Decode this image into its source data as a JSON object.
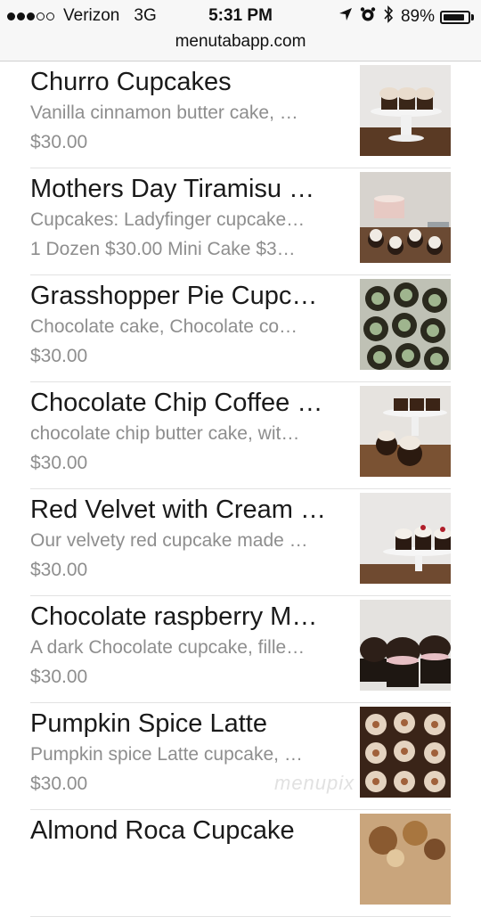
{
  "status_bar": {
    "signal_bars_filled": 3,
    "signal_bars_total": 5,
    "carrier": "Verizon",
    "network": "3G",
    "time": "5:31 PM",
    "battery_percent": "89%",
    "battery_level": 0.89,
    "icons": [
      "location-arrow-icon",
      "alarm-clock-icon",
      "bluetooth-icon",
      "battery-icon"
    ]
  },
  "browser": {
    "url": "menutabapp.com"
  },
  "menu_items": [
    {
      "title": "Churro Cupcakes",
      "description": "Vanilla cinnamon butter cake, …",
      "price": "$30.00"
    },
    {
      "title": "Mothers Day Tiramisu …",
      "description": "Cupcakes: Ladyfinger cupcake…",
      "price": "1 Dozen $30.00   Mini Cake $3…"
    },
    {
      "title": "Grasshopper Pie Cupc…",
      "description": "Chocolate cake, Chocolate co…",
      "price": "$30.00"
    },
    {
      "title": "Chocolate Chip Coffee …",
      "description": "chocolate chip butter cake, wit…",
      "price": "$30.00"
    },
    {
      "title": "Red Velvet with Cream …",
      "description": "Our velvety red cupcake made …",
      "price": "$30.00"
    },
    {
      "title": "Chocolate raspberry M…",
      "description": "A dark Chocolate cupcake, fille…",
      "price": "$30.00"
    },
    {
      "title": "Pumpkin Spice Latte",
      "description": "Pumpkin spice Latte cupcake, …",
      "price": "$30.00"
    },
    {
      "title": "Almond Roca Cupcake",
      "description": "",
      "price": ""
    }
  ],
  "watermark": "menupix"
}
